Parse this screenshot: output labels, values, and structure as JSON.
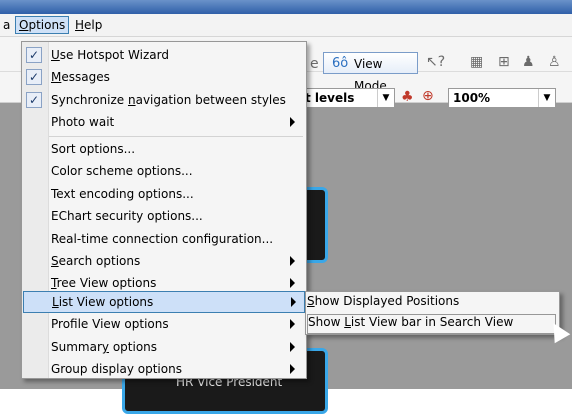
{
  "menubar": {
    "items": [
      {
        "label": "a"
      },
      {
        "label": "Options",
        "mnemonic": "O",
        "rest": "ptions"
      },
      {
        "label": "Help",
        "mnemonic": "H",
        "rest": "elp"
      }
    ]
  },
  "toolbar": {
    "view_mode_label": "View Mode",
    "levels_label": "t levels",
    "zoom_value": "100%"
  },
  "canvas": {
    "node_label": "HR Vice President"
  },
  "options_menu": {
    "items": [
      {
        "pre": "",
        "mn": "U",
        "post": "se Hotspot Wizard",
        "checked": true
      },
      {
        "pre": "",
        "mn": "M",
        "post": "essages",
        "checked": true
      },
      {
        "pre": "Synchronize ",
        "mn": "n",
        "post": "avigation between styles",
        "checked": true
      },
      {
        "pre": "Photo wait",
        "mn": "",
        "post": "",
        "submenu": true
      },
      {
        "pre": "Sort options...",
        "mn": "",
        "post": ""
      },
      {
        "pre": "Color scheme options...",
        "mn": "",
        "post": ""
      },
      {
        "pre": "Text encoding options...",
        "mn": "",
        "post": ""
      },
      {
        "pre": "EChart security options...",
        "mn": "",
        "post": ""
      },
      {
        "pre": "Real-time connection configuration...",
        "mn": "",
        "post": ""
      },
      {
        "pre": "",
        "mn": "S",
        "post": "earch options",
        "submenu": true
      },
      {
        "pre": "",
        "mn": "T",
        "post": "ree View options",
        "submenu": true
      },
      {
        "pre": "",
        "mn": "L",
        "post": "ist View options",
        "submenu": true,
        "highlighted": true
      },
      {
        "pre": "Profile View options",
        "mn": "",
        "post": "",
        "submenu": true
      },
      {
        "pre": "Summar",
        "mn": "y",
        "post": " options",
        "submenu": true
      },
      {
        "pre": "Group display options",
        "mn": "",
        "post": "",
        "submenu": true
      }
    ]
  },
  "list_view_submenu": {
    "items": [
      {
        "pre": "",
        "mn": "S",
        "post": "how Displayed Positions"
      },
      {
        "pre": "Show ",
        "mn": "L",
        "post": "ist View bar in Search View",
        "highlighted": true
      }
    ]
  },
  "colors": {
    "menu_highlight": "#cde0f8",
    "highlight_border": "#3c7fb1",
    "node_border": "#39a7e8"
  }
}
